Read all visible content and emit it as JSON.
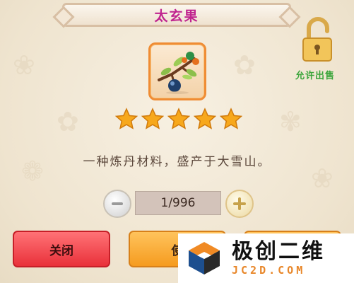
{
  "dialog": {
    "title": "太玄果",
    "item_icon": "tree-branch-fruit-icon",
    "rarity_stars": 5,
    "description": "一种炼丹材料，盛产于大雪山。",
    "sell_status": {
      "icon": "unlocked-padlock-icon",
      "label": "允许出售"
    },
    "quantity": {
      "value": "1/996",
      "minus_icon": "minus-icon",
      "plus_icon": "plus-icon"
    },
    "buttons": {
      "close_label": "关闭",
      "use_label": "使"
    }
  },
  "watermark": {
    "title": "极创二维",
    "subtitle": "JC2D.COM"
  },
  "colors": {
    "title": "#c0248f",
    "close_button": "#e9313a",
    "action_button": "#f59b1f",
    "sell_label": "#3aa53a",
    "star": "#f7a81c"
  }
}
